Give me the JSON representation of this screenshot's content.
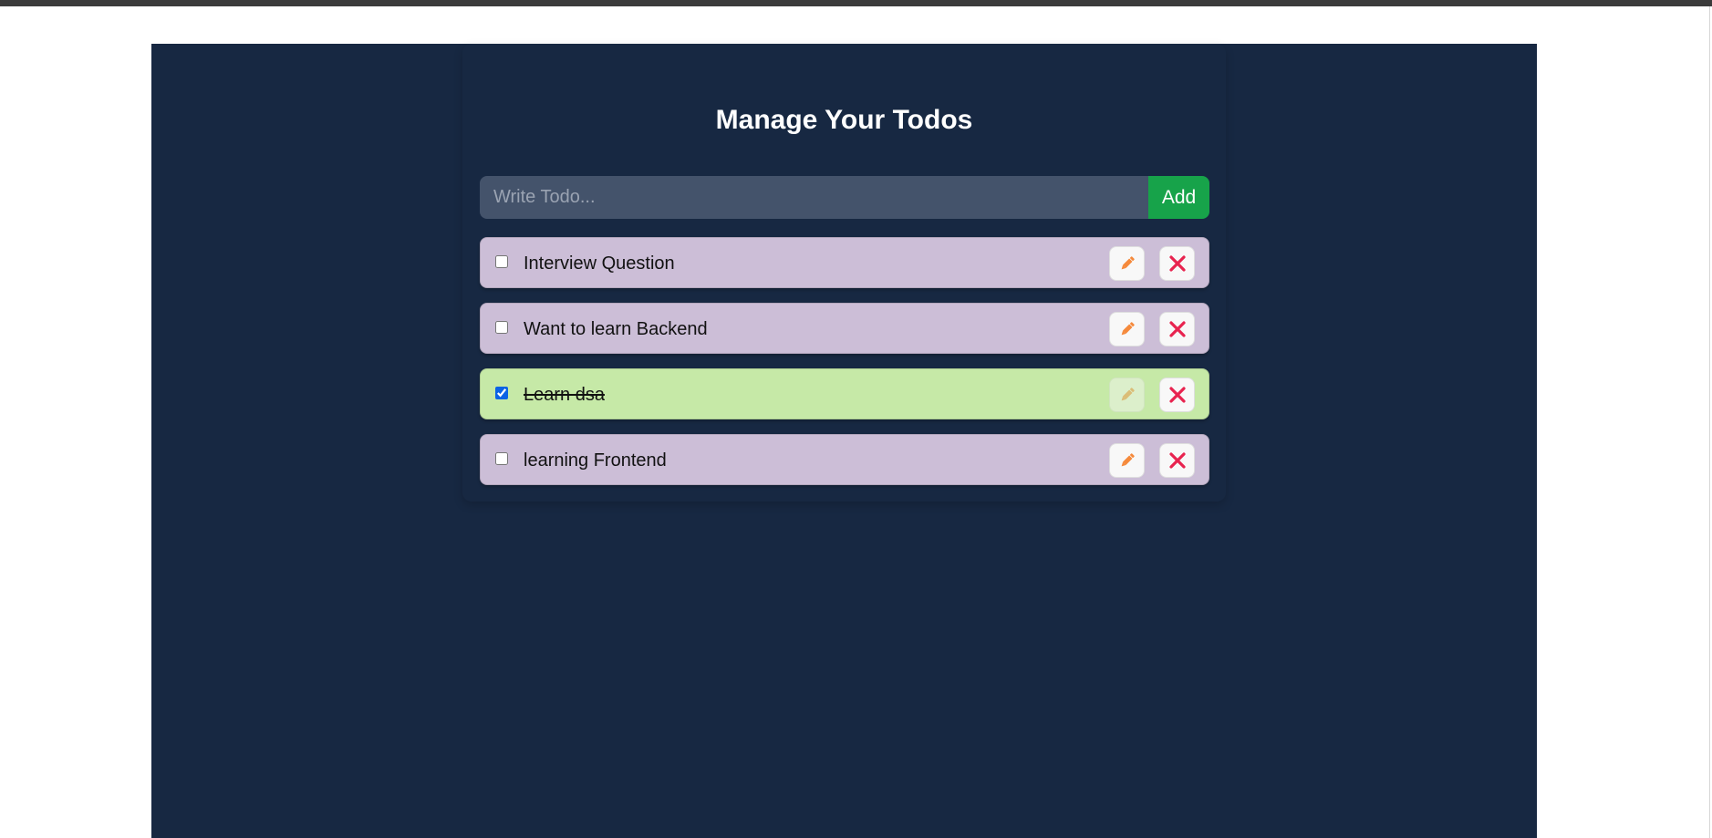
{
  "app": {
    "title": "Manage Your Todos"
  },
  "form": {
    "placeholder": "Write Todo...",
    "value": "",
    "add_label": "Add"
  },
  "colors": {
    "background": "#172842",
    "pending_item": "#ccbed7",
    "completed_item": "#c6e9a7",
    "add_button": "#17a34a",
    "edit_icon": "#f5893b",
    "delete_icon": "#e8234f"
  },
  "todos": [
    {
      "text": "Interview Question",
      "completed": false,
      "edit_icon": "pencil-icon",
      "delete_icon": "close-icon"
    },
    {
      "text": "Want to learn Backend",
      "completed": false,
      "edit_icon": "pencil-icon",
      "delete_icon": "close-icon"
    },
    {
      "text": "Learn dsa",
      "completed": true,
      "edit_icon": "pencil-icon",
      "delete_icon": "close-icon"
    },
    {
      "text": "learning Frontend",
      "completed": false,
      "edit_icon": "pencil-icon",
      "delete_icon": "close-icon"
    }
  ]
}
